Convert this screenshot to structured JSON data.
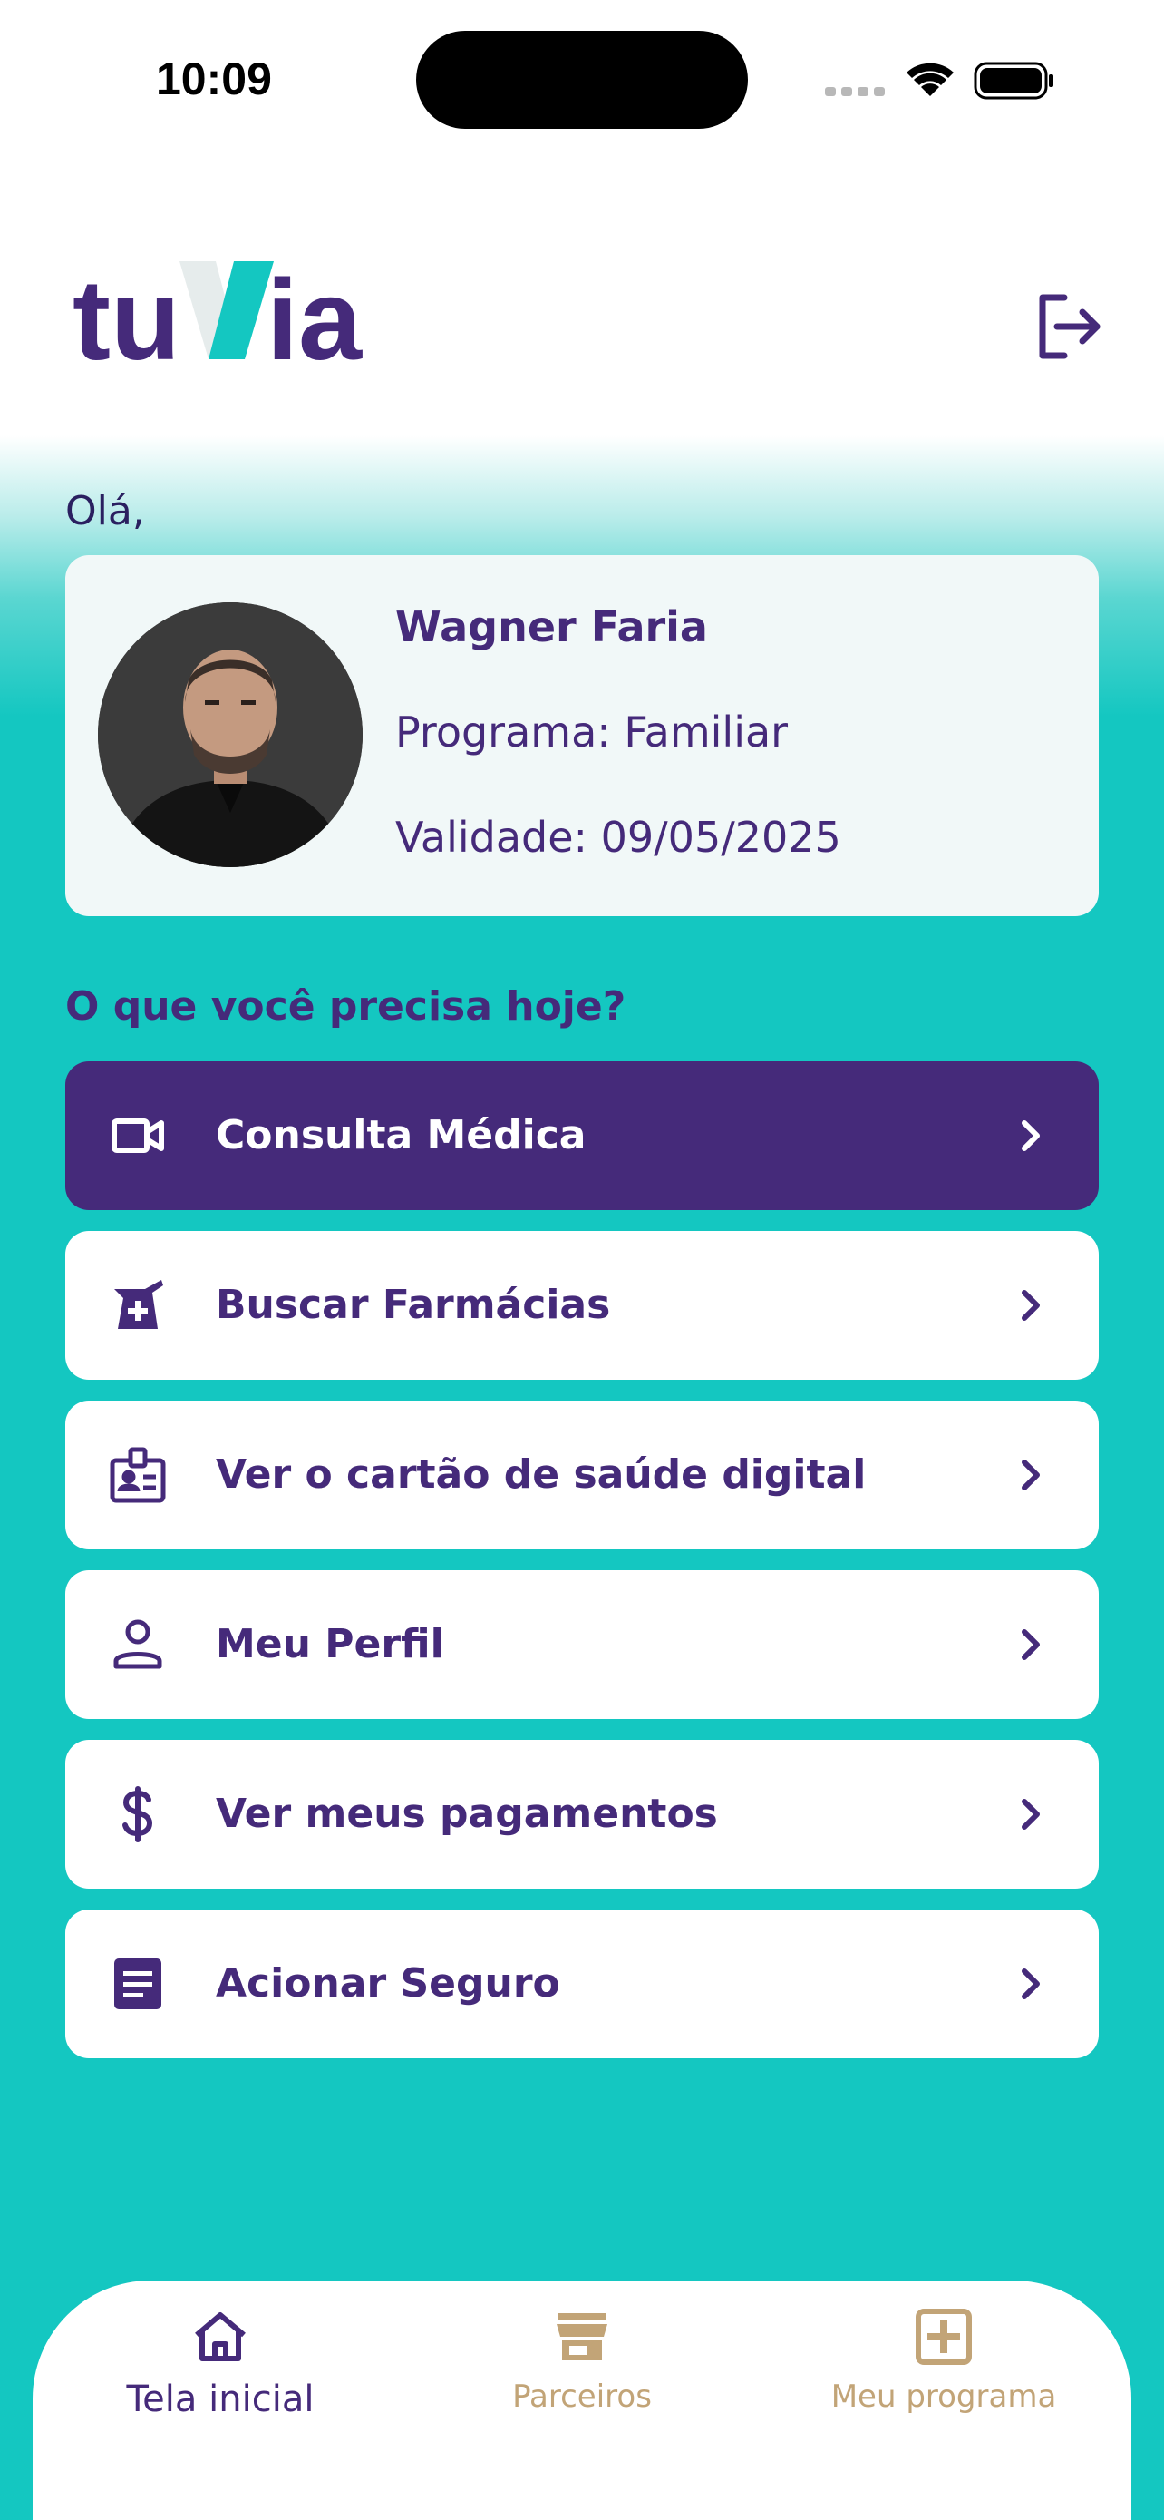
{
  "status_bar": {
    "time": "10:09"
  },
  "header": {
    "logo_text": "tuVia",
    "logout_icon": "logout-icon"
  },
  "greeting": "Olá,",
  "profile": {
    "name": "Wagner Faria",
    "program": "Programa: Familiar",
    "validity": "Validade: 09/05/2025"
  },
  "question": "O que você precisa hoje?",
  "menu": [
    {
      "label": "Consulta Médica",
      "icon": "video-camera-icon"
    },
    {
      "label": "Buscar Farmácias",
      "icon": "pharmacy-icon"
    },
    {
      "label": "Ver o cartão de saúde digital",
      "icon": "id-badge-icon"
    },
    {
      "label": "Meu Perfil",
      "icon": "person-icon"
    },
    {
      "label": "Ver meus pagamentos",
      "icon": "dollar-icon"
    },
    {
      "label": "Acionar Seguro",
      "icon": "document-icon"
    }
  ],
  "bottom_nav": [
    {
      "label": "Tela inicial",
      "icon": "home-icon",
      "active": true
    },
    {
      "label": "Parceiros",
      "icon": "store-icon",
      "active": false
    },
    {
      "label": "Meu programa",
      "icon": "medical-plus-icon",
      "active": false
    }
  ],
  "colors": {
    "brand_purple": "#452a7a",
    "brand_teal": "#14C7C1",
    "inactive_tab": "#c2a477"
  }
}
